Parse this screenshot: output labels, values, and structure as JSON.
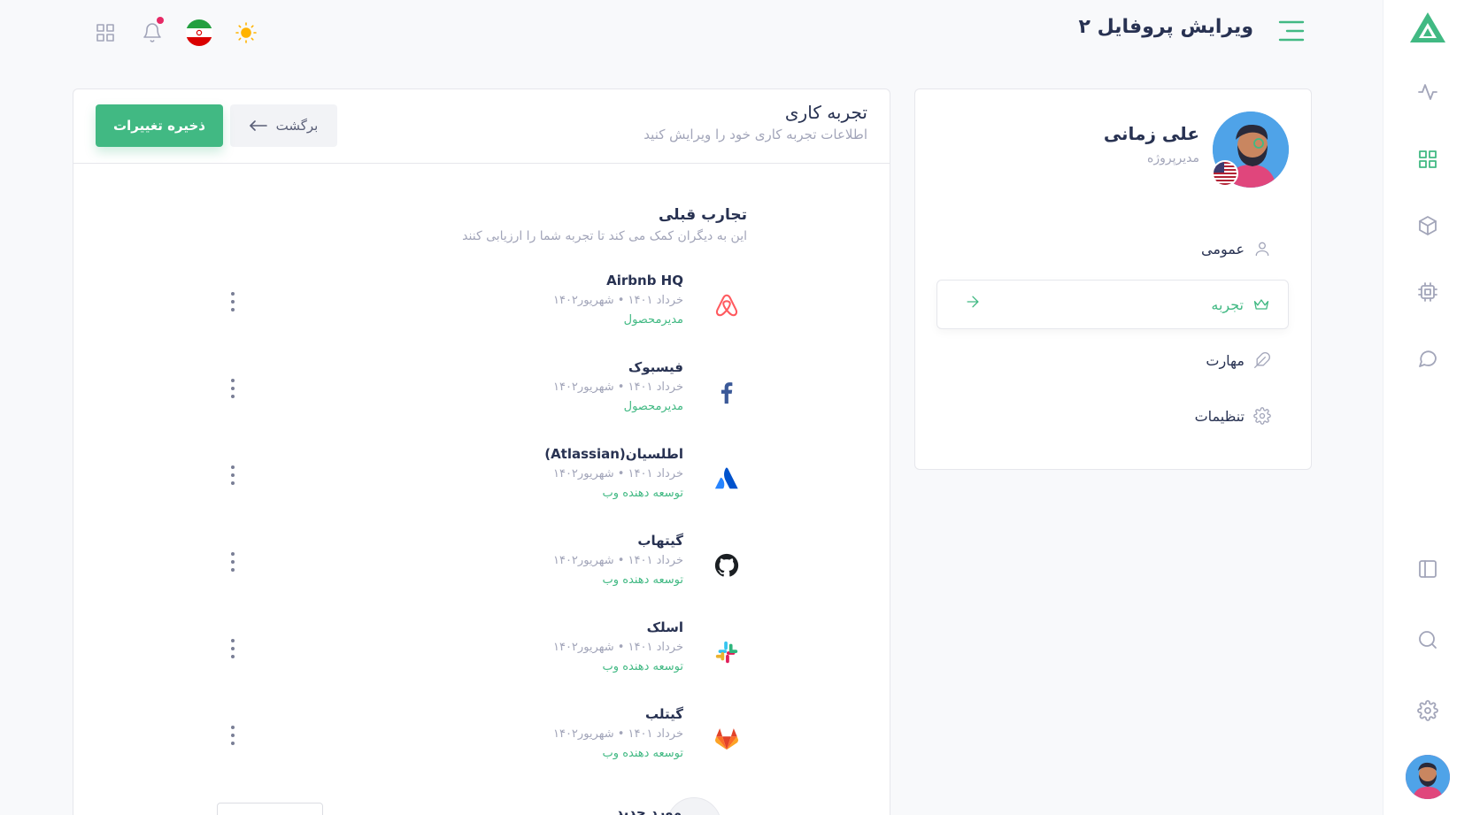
{
  "header": {
    "title": "ویرایش پروفایل ۲"
  },
  "topbar": {
    "icons": [
      "apps-grid-icon",
      "bell-icon",
      "iran-flag-icon",
      "sun-icon"
    ]
  },
  "rail": {
    "icons": [
      "logo-icon",
      "activity-icon",
      "dashboard-grid-icon",
      "box-icon",
      "cpu-icon",
      "chat-icon",
      "layout-icon",
      "search-icon",
      "settings-icon"
    ],
    "active_icon": "dashboard-grid-icon"
  },
  "profile": {
    "name": "علی زمانی",
    "role": "مدیرپروژه",
    "menu": [
      {
        "label": "عمومی",
        "icon": "user-icon"
      },
      {
        "label": "تجربه",
        "icon": "crown-icon"
      },
      {
        "label": "مهارت",
        "icon": "feather-icon"
      },
      {
        "label": "تنظیمات",
        "icon": "settings-icon"
      }
    ],
    "active_menu": "تجربه"
  },
  "main": {
    "title": "تجربه کاری",
    "subtitle": "اطلاعات تجربه کاری خود را ویرایش کنید",
    "save_label": "ذخیره تغییرات",
    "back_label": "برگشت",
    "section_title": "تجارب قبلی",
    "section_subtitle": "این به دیگران کمک می کند تا تجربه شما را ارزیابی کنند",
    "experiences": [
      {
        "company": "Airbnb HQ",
        "start": "خرداد ۱۴۰۱",
        "end": "شهریور۱۴۰۲",
        "role": "مدیرمحصول",
        "logo": "airbnb-icon"
      },
      {
        "company": "فیسبوک",
        "start": "خرداد ۱۴۰۱",
        "end": "شهریور۱۴۰۲",
        "role": "مدیرمحصول",
        "logo": "facebook-icon"
      },
      {
        "company": "اطلسیان(Atlassian)",
        "start": "خرداد ۱۴۰۱",
        "end": "شهریور۱۴۰۲",
        "role": "توسعه دهنده وب",
        "logo": "atlassian-icon"
      },
      {
        "company": "گیتهاب",
        "start": "خرداد ۱۴۰۱",
        "end": "شهریور۱۴۰۲",
        "role": "توسعه دهنده وب",
        "logo": "github-icon"
      },
      {
        "company": "اسلک",
        "start": "خرداد ۱۴۰۱",
        "end": "شهریور۱۴۰۲",
        "role": "توسعه دهنده وب",
        "logo": "slack-icon"
      },
      {
        "company": "گیتلب",
        "start": "خرداد ۱۴۰۱",
        "end": "شهریور۱۴۰۲",
        "role": "توسعه دهنده وب",
        "logo": "gitlab-icon"
      }
    ],
    "new_item_label": "مورد جدید"
  },
  "colors": {
    "accent": "#41b983",
    "muted": "#a2a5b9",
    "text": "#283252",
    "notification": "#e62965"
  }
}
